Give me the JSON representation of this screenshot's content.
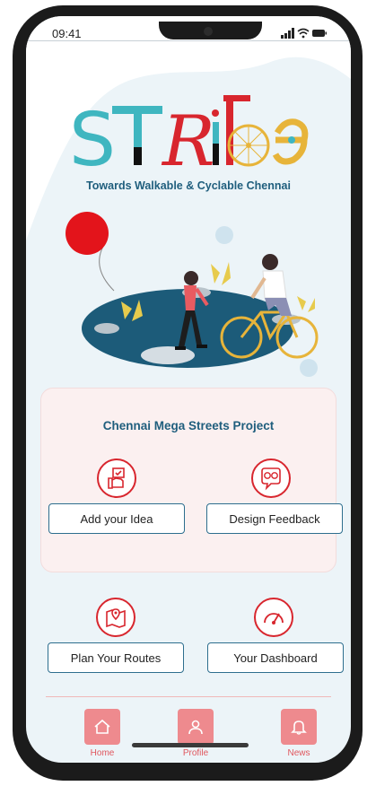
{
  "status_bar": {
    "time": "09:41"
  },
  "brand": {
    "logo_letters": [
      "S",
      "T",
      "R",
      "i",
      "d",
      "e"
    ],
    "tagline": "Towards Walkable & Cyclable Chennai"
  },
  "project_card": {
    "title": "Chennai Mega Streets Project",
    "add_idea_label": "Add your Idea",
    "design_feedback_label": "Design Feedback"
  },
  "actions": {
    "plan_routes_label": "Plan Your Routes",
    "dashboard_label": "Your Dashboard"
  },
  "bottom_nav": [
    {
      "label": "Home",
      "icon": "home-icon"
    },
    {
      "label": "Profile",
      "icon": "user-icon"
    },
    {
      "label": "News",
      "icon": "bell-icon"
    }
  ],
  "colors": {
    "accent_red": "#d8262e",
    "brand_blue": "#1f5e7d",
    "nav_pink": "#ee8a8e",
    "logo_teal": "#3fb6c0",
    "logo_yellow": "#e7b43a"
  }
}
